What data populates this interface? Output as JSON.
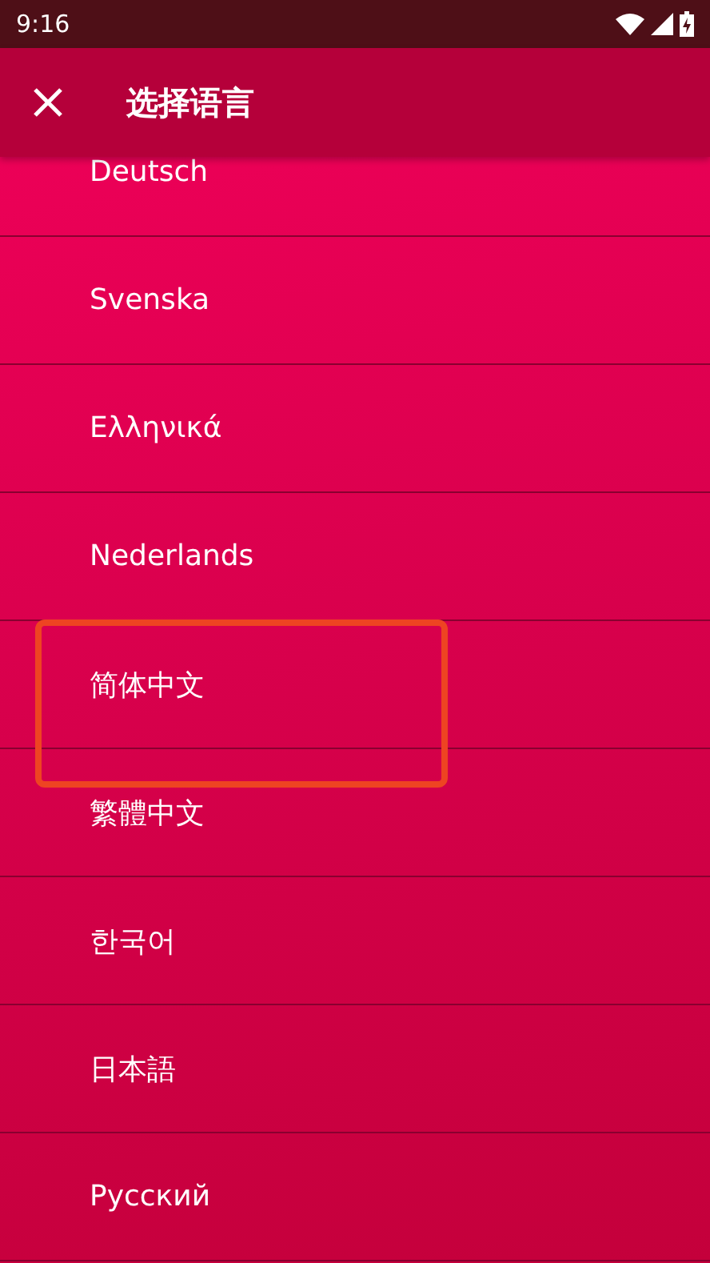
{
  "status_bar": {
    "time": "9:16"
  },
  "toolbar": {
    "title": "选择语言"
  },
  "languages": [
    {
      "label": "Deutsch",
      "highlighted": false
    },
    {
      "label": "Svenska",
      "highlighted": false
    },
    {
      "label": "Ελληνικά",
      "highlighted": false
    },
    {
      "label": "Nederlands",
      "highlighted": false
    },
    {
      "label": "简体中文",
      "highlighted": true
    },
    {
      "label": "繁體中文",
      "highlighted": false
    },
    {
      "label": "한국어",
      "highlighted": false
    },
    {
      "label": "日本語",
      "highlighted": false
    },
    {
      "label": "Русский",
      "highlighted": false
    }
  ]
}
